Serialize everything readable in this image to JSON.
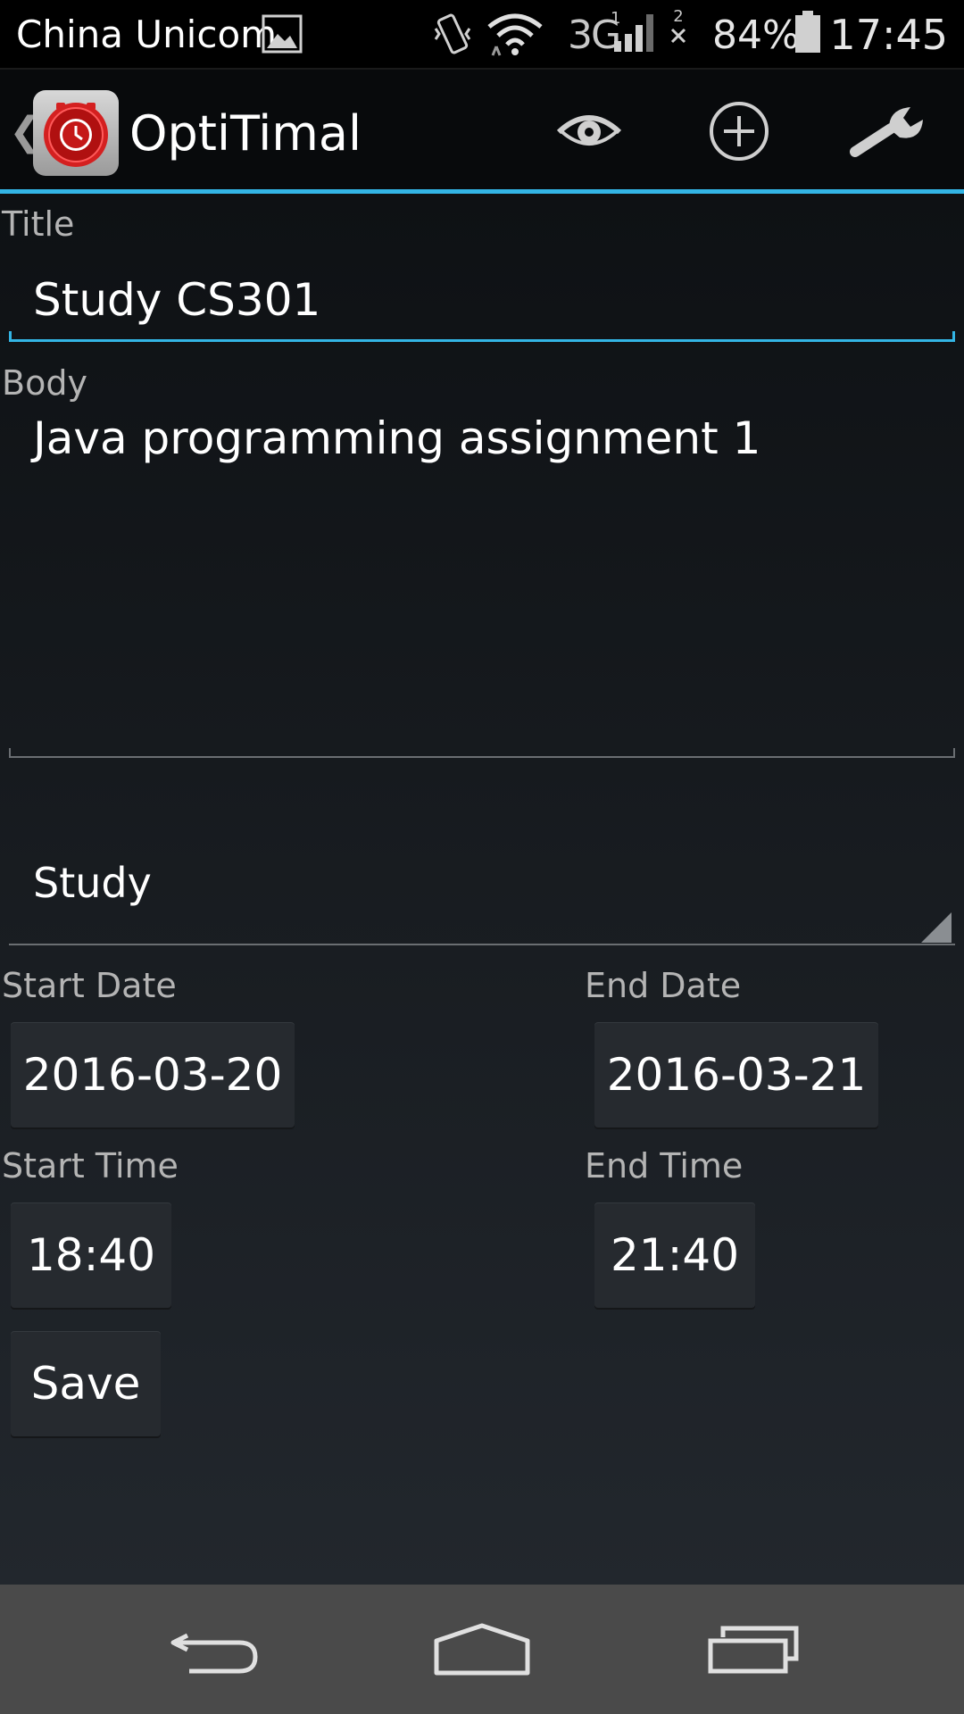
{
  "status_bar": {
    "carrier": "China Unicom",
    "network": "3G",
    "sim1_label": "1",
    "sim2_label": "2",
    "battery_percent": "84%",
    "time": "17:45",
    "icons": [
      "image-notification-icon",
      "vibrate-icon",
      "wifi-icon",
      "signal-icon",
      "sim2-no-signal-icon",
      "battery-icon"
    ]
  },
  "action_bar": {
    "title": "OptiTimal",
    "actions": [
      "view-icon",
      "add-icon",
      "settings-wrench-icon"
    ],
    "accent_color": "#33b5e5"
  },
  "form": {
    "title_label": "Title",
    "title_value": "Study CS301",
    "body_label": "Body",
    "body_value": "Java programming assignment 1",
    "category_value": "Study",
    "start_date_label": "Start Date",
    "start_date_value": "2016-03-20",
    "end_date_label": "End Date",
    "end_date_value": "2016-03-21",
    "start_time_label": "Start Time",
    "start_time_value": "18:40",
    "end_time_label": "End Time",
    "end_time_value": "21:40",
    "save_label": "Save"
  },
  "nav_bar": {
    "icons": [
      "back-icon",
      "home-icon",
      "recent-apps-icon"
    ]
  }
}
